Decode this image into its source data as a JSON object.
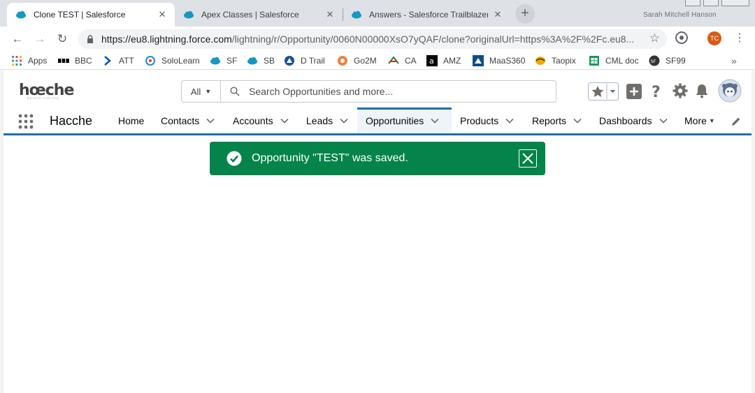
{
  "browser": {
    "tabs": [
      {
        "title": "Clone TEST | Salesforce",
        "active": true
      },
      {
        "title": "Apex Classes | Salesforce",
        "active": false
      },
      {
        "title": "Answers - Salesforce Trailblazer C",
        "active": false
      }
    ],
    "profile_hint": "Sarah Mitchell Hanson",
    "url_host": "https://eu8.lightning.force.com",
    "url_path": "/lightning/r/Opportunity/0060N00000XsO7yQAF/clone?originalUrl=https%3A%2F%2Fc.eu8...",
    "profile_initials": "TC",
    "bookmarks": [
      {
        "label": "Apps",
        "icon": "apps-grid-icon",
        "color": "#4285f4"
      },
      {
        "label": "BBC",
        "icon": "bbc-icon",
        "color": "#000000"
      },
      {
        "label": "ATT",
        "icon": "chevron-right-icon",
        "color": "#0057b8"
      },
      {
        "label": "SoloLearn",
        "icon": "sololearn-icon",
        "color": "#1e88e5"
      },
      {
        "label": "SF",
        "icon": "salesforce-cloud-icon",
        "color": "#1798c1"
      },
      {
        "label": "SB",
        "icon": "salesforce-cloud-icon",
        "color": "#1798c1"
      },
      {
        "label": "D Trail",
        "icon": "trailhead-icon",
        "color": "#1b5297"
      },
      {
        "label": "Go2M",
        "icon": "go2m-icon",
        "color": "#e8843a"
      },
      {
        "label": "CA",
        "icon": "ca-icon",
        "color": "#2e7d32"
      },
      {
        "label": "AMZ",
        "icon": "amazon-icon",
        "color": "#000000"
      },
      {
        "label": "MaaS360",
        "icon": "maas360-icon",
        "color": "#0f4c8a"
      },
      {
        "label": "Taopix",
        "icon": "taopix-icon",
        "color": "#f2a900"
      },
      {
        "label": "CML doc",
        "icon": "sheets-icon",
        "color": "#0f9d58"
      },
      {
        "label": "SF99",
        "icon": "sf99-icon",
        "color": "#333333"
      }
    ]
  },
  "sf": {
    "logo_text": "hœche",
    "logo_sub": "ESTATE LIMITED",
    "search": {
      "scope": "All",
      "placeholder": "Search Opportunities and more..."
    },
    "app_name": "Hacche",
    "nav": [
      {
        "label": "Home",
        "dropdown": false,
        "active": false
      },
      {
        "label": "Contacts",
        "dropdown": true,
        "active": false
      },
      {
        "label": "Accounts",
        "dropdown": true,
        "active": false
      },
      {
        "label": "Leads",
        "dropdown": true,
        "active": false
      },
      {
        "label": "Opportunities",
        "dropdown": true,
        "active": true
      },
      {
        "label": "Products",
        "dropdown": true,
        "active": false
      },
      {
        "label": "Reports",
        "dropdown": true,
        "active": false
      },
      {
        "label": "Dashboards",
        "dropdown": true,
        "active": false
      }
    ],
    "more_label": "More",
    "accent_color": "#1b6eb7"
  },
  "toast": {
    "message": "Opportunity \"TEST\" was saved.",
    "color": "#04844b"
  }
}
